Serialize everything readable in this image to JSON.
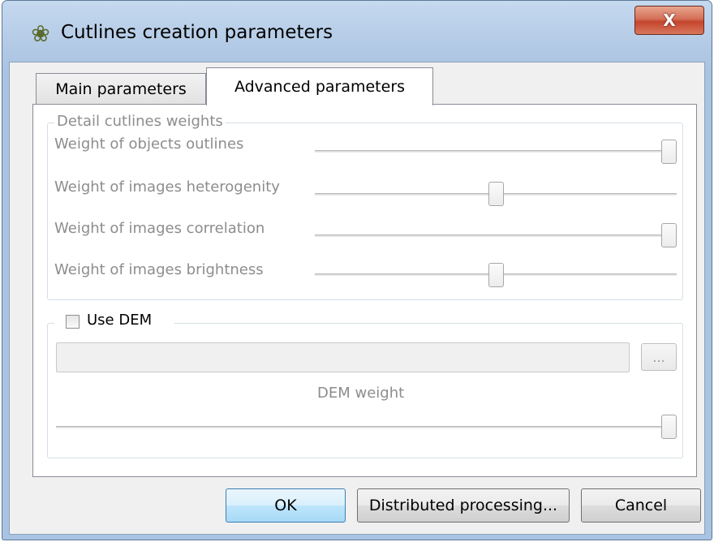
{
  "window": {
    "title": "Cutlines creation parameters",
    "close_label": "X",
    "title_icon": "puzzle-gear-icon"
  },
  "tabs": [
    {
      "label": "Main parameters",
      "active": false
    },
    {
      "label": "Advanced parameters",
      "active": true
    }
  ],
  "detail_group": {
    "title": "Detail cutlines weights",
    "sliders": [
      {
        "label": "Weight of objects outlines",
        "value_fraction": 1.0
      },
      {
        "label": "Weight of images heterogenity",
        "value_fraction": 0.5
      },
      {
        "label": "Weight of images correlation",
        "value_fraction": 1.0
      },
      {
        "label": "Weight of images brightness",
        "value_fraction": 0.5
      }
    ]
  },
  "dem_group": {
    "checkbox_label": "Use DEM",
    "checked": false,
    "path_value": "",
    "browse_label": "...",
    "weight_label": "DEM weight",
    "weight_fraction": 1.0
  },
  "buttons": {
    "ok": "OK",
    "distributed": "Distributed processing...",
    "cancel": "Cancel"
  }
}
